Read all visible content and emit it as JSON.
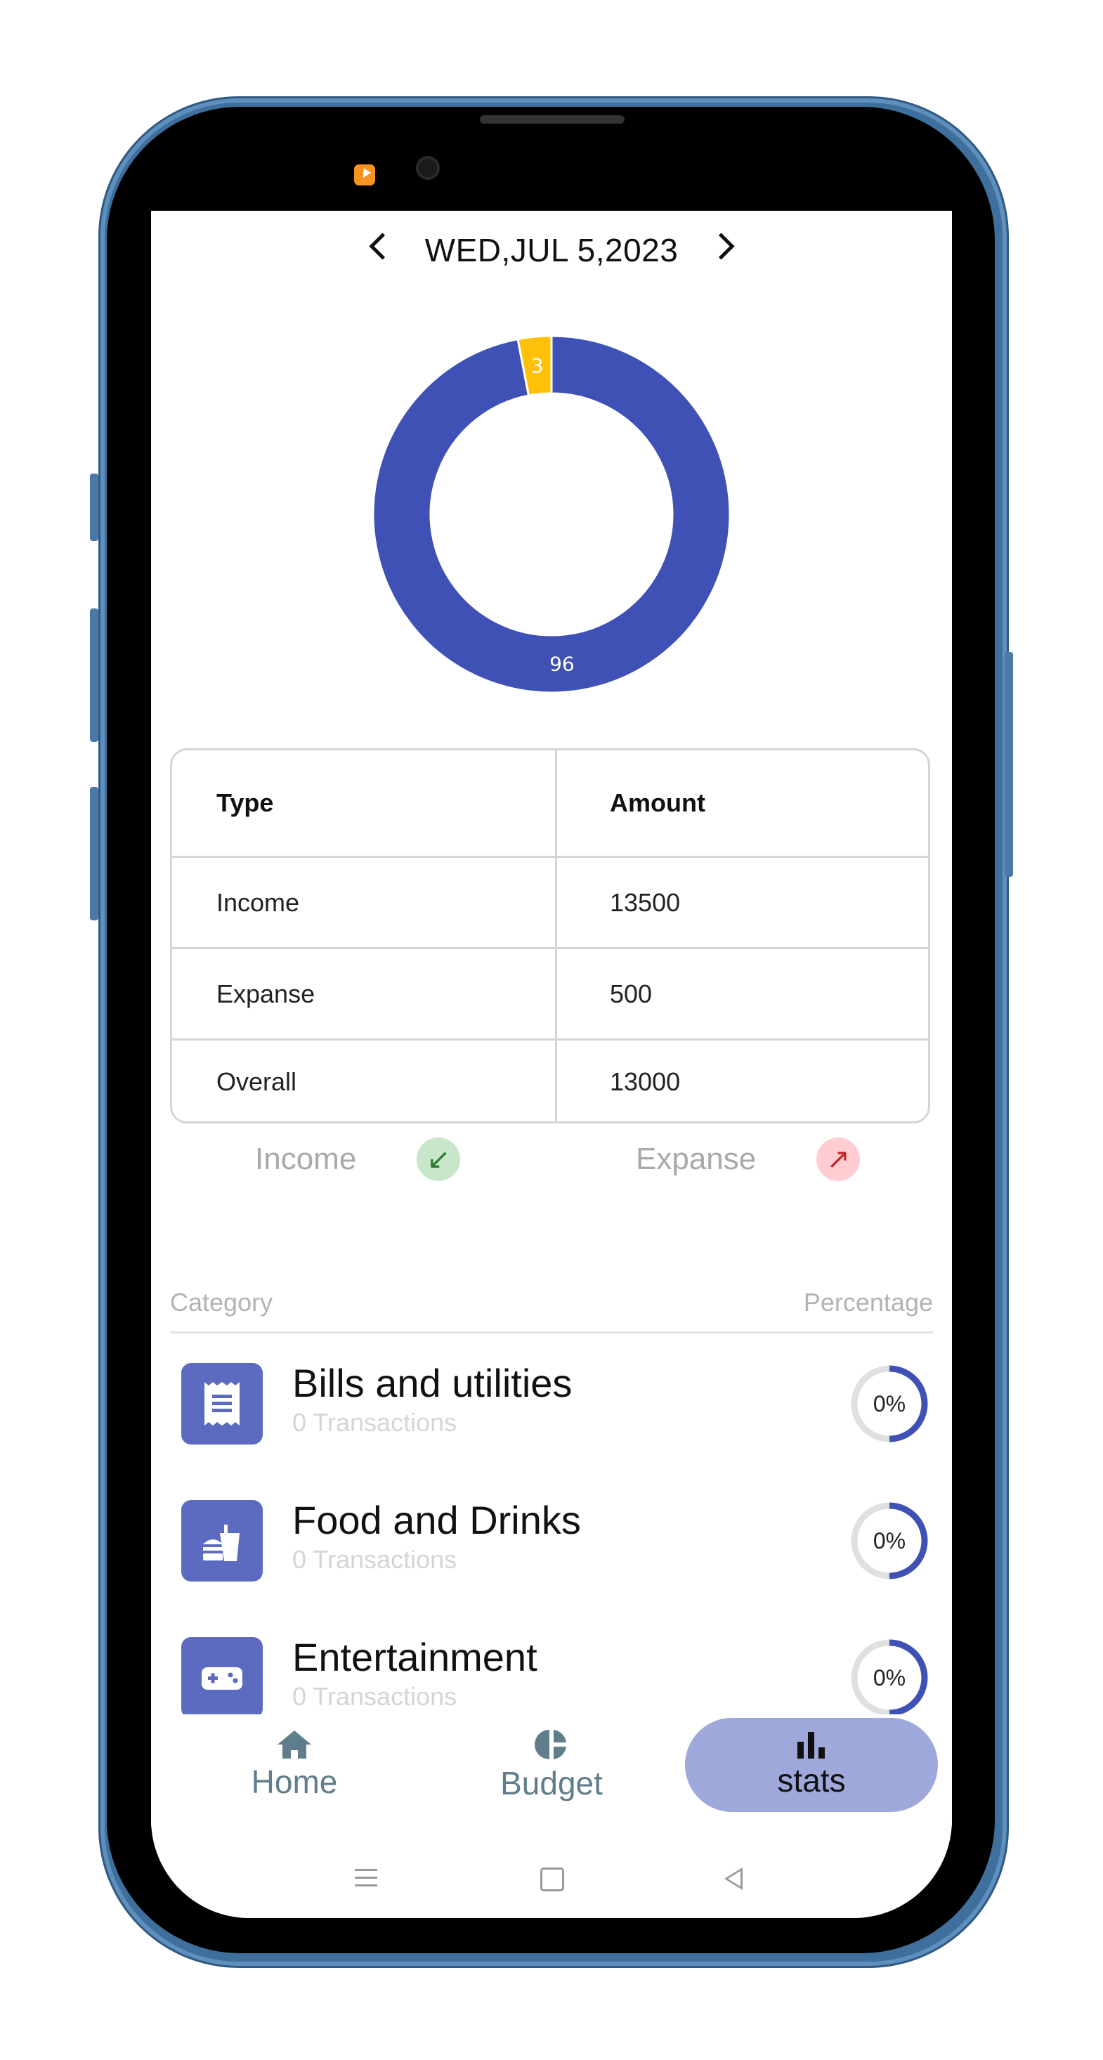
{
  "header": {
    "date": "WED,JUL 5,2023"
  },
  "chart_data": {
    "type": "pie",
    "title": "",
    "categories": [
      "Income",
      "Expanse"
    ],
    "values": [
      96,
      3
    ],
    "colors": [
      "#3f51b5",
      "#ffc107"
    ],
    "labels": [
      "96",
      "3"
    ]
  },
  "table": {
    "headers": [
      "Type",
      "Amount"
    ],
    "rows": [
      [
        "Income",
        "13500"
      ],
      [
        "Expanse",
        "500"
      ],
      [
        "Overall",
        "13000"
      ]
    ]
  },
  "toggles": {
    "income_label": "Income",
    "expanse_label": "Expanse"
  },
  "category_header": {
    "left": "Category",
    "right": "Percentage"
  },
  "categories": [
    {
      "title": "Bills and utilities",
      "subtitle": "0 Transactions",
      "percent": "0%",
      "icon": "receipt-icon",
      "fraction": 0
    },
    {
      "title": "Food and Drinks",
      "subtitle": "0 Transactions",
      "percent": "0%",
      "icon": "fastfood-icon",
      "fraction": 0
    },
    {
      "title": "Entertainment",
      "subtitle": "0 Transactions",
      "percent": "0%",
      "icon": "gamepad-icon",
      "fraction": 0
    }
  ],
  "bottom_nav": [
    {
      "label": "Home",
      "icon": "home-icon"
    },
    {
      "label": "Budget",
      "icon": "pie-chart-icon"
    },
    {
      "label": "stats",
      "icon": "bar-chart-icon",
      "active": true
    }
  ],
  "colors": {
    "primary": "#3f51b5",
    "accent": "#ffc107",
    "nav_active_bg": "#9fa8da",
    "category_icon_bg": "#5c6bc0"
  }
}
